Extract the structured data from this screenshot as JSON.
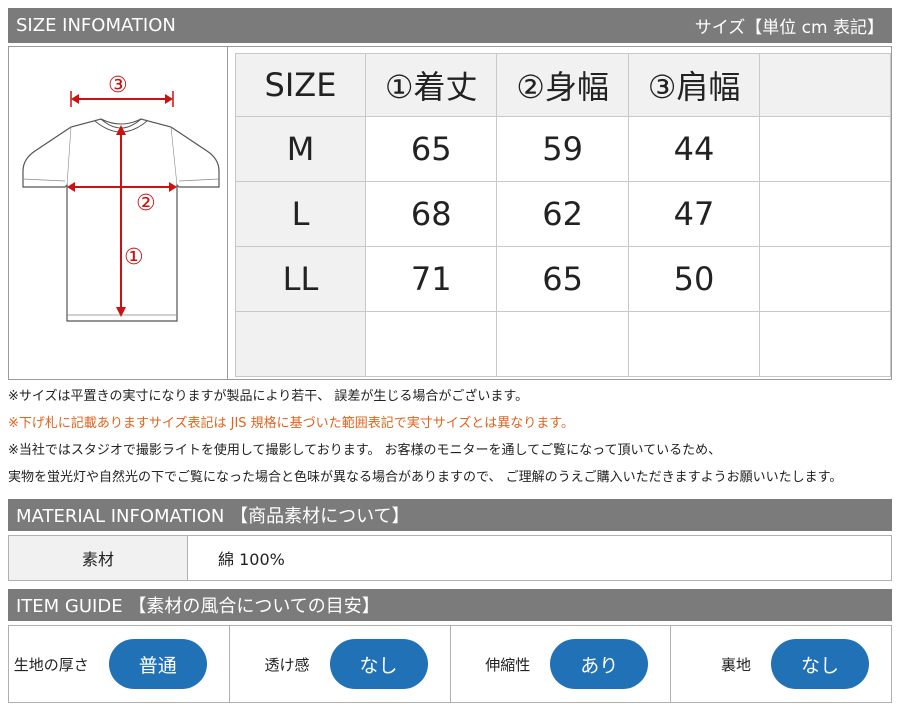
{
  "size_header": {
    "title": "SIZE  INFOMATION",
    "unit_note": "サイズ【単位  cm 表記】"
  },
  "diagram": {
    "marker_1": "①",
    "marker_2": "②",
    "marker_3": "③"
  },
  "size_table": {
    "headers": [
      "SIZE",
      "①着丈",
      "②身幅",
      "③肩幅",
      ""
    ],
    "rows": [
      [
        "M",
        "65",
        "59",
        "44",
        ""
      ],
      [
        "L",
        "68",
        "62",
        "47",
        ""
      ],
      [
        "LL",
        "71",
        "65",
        "50",
        ""
      ],
      [
        "",
        "",
        "",
        "",
        ""
      ]
    ]
  },
  "notes": [
    "※サイズは平置きの実寸になりますが製品により若干、 誤差が生じる場合がございます。",
    "※下げ札に記載ありますサイズ表記は JIS 規格に基づいた範囲表記で実寸サイズとは異なります。",
    "※当社ではスタジオで撮影ライトを使用して撮影しております。 お客様のモニターを通してご覧になって頂いているため、",
    "実物を蛍光灯や自然光の下でご覧になった場合と色味が異なる場合がありますので、 ご理解のうえご購入いただきますようお願いいたします。"
  ],
  "material_header": {
    "title": "MATERIAL INFOMATION 【商品素材について】"
  },
  "material": {
    "label": "素材",
    "value": "綿 100%"
  },
  "guide_header": {
    "title": "ITEM GUIDE 【素材の風合についての目安】"
  },
  "guide": [
    {
      "label": "生地の厚さ",
      "value": "普通"
    },
    {
      "label": "透け感",
      "value": "なし"
    },
    {
      "label": "伸縮性",
      "value": "あり"
    },
    {
      "label": "裏地",
      "value": "なし"
    }
  ],
  "colors": {
    "header_bg": "#7b7b7b",
    "pill": "#2071b5",
    "arrow": "#cc1111",
    "note_orange": "#e0641e"
  }
}
